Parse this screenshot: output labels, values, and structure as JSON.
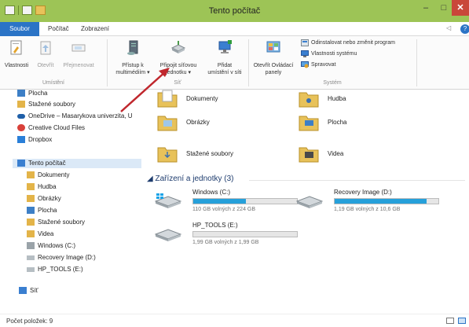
{
  "window": {
    "title": "Tento počítač",
    "minimize": "–",
    "maximize": "□",
    "close": "✕"
  },
  "ribbon_tabs": {
    "file": "Soubor",
    "computer": "Počítač",
    "view": "Zobrazení",
    "help_arrow": "◁"
  },
  "ribbon": {
    "groups": {
      "location": "Umístění",
      "network": "Síť",
      "system": "Systém"
    },
    "buttons": {
      "properties": "Vlastnosti",
      "open": "Otevřít",
      "rename": "Přejmenovat",
      "media_access_1": "Přístup k",
      "media_access_2": "multimédiím ▾",
      "map_drive_1": "Připojit síťovou",
      "map_drive_2": "jednotku ▾",
      "add_location_1": "Přidat",
      "add_location_2": "umístění v síti",
      "control_panel_1": "Otevřít Ovládací",
      "control_panel_2": "panely"
    },
    "system_items": {
      "uninstall": "Odinstalovat nebo změnit program",
      "system_properties": "Vlastnosti systému",
      "manage": "Spravovat"
    }
  },
  "nav": {
    "items": [
      "Plocha",
      "Stažené soubory",
      "OneDrive – Masarykova univerzita, U",
      "Creative Cloud Files",
      "Dropbox",
      "Tento počítač",
      "Dokumenty",
      "Hudba",
      "Obrázky",
      "Plocha",
      "Stažené soubory",
      "Videa",
      "Windows (C:)",
      "Recovery Image (D:)",
      "HP_TOOLS (E:)",
      "Síť"
    ]
  },
  "folders": [
    {
      "name": "Dokumenty"
    },
    {
      "name": "Hudba"
    },
    {
      "name": "Obrázky"
    },
    {
      "name": "Plocha"
    },
    {
      "name": "Stažené soubory"
    },
    {
      "name": "Videa"
    }
  ],
  "devices_section": {
    "title": "Zařízení a jednotky (3)"
  },
  "drives": [
    {
      "name": "Windows (C:)",
      "free": "110 GB volných z 224 GB",
      "used_fraction": 0.51
    },
    {
      "name": "Recovery Image (D:)",
      "free": "1,19 GB volných z 10,6 GB",
      "used_fraction": 0.89
    },
    {
      "name": "HP_TOOLS (E:)",
      "free": "1,99 GB volných z 1,99 GB",
      "used_fraction": 0.0
    }
  ],
  "status": {
    "count": "Počet položek: 9"
  },
  "colors": {
    "titlebar": "#9dc456",
    "accent": "#2b74c6",
    "drive_bar": "#26a0da",
    "arrow": "#c0272d"
  }
}
